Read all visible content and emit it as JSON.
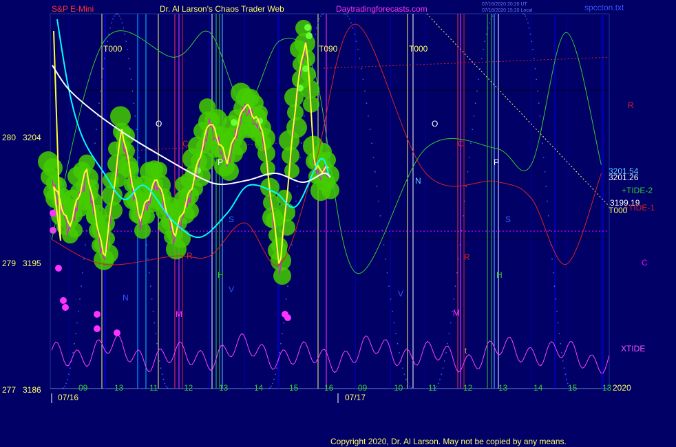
{
  "header": {
    "instrument": "S&P E-Mini",
    "site_title": "Dr. Al Larson's Chaos Trader Web",
    "site_url": "Daytradingforecasts.com",
    "stamp_line1": "07/16/2020 20:20 UT",
    "stamp_line2": "07/16/2020 15:20 Local",
    "file_name": "spccton.txt"
  },
  "footer": {
    "copyright": "Copyright 2020, Dr. Al Larson. May not be copied by any means."
  },
  "chart_data": {
    "type": "line",
    "title": "",
    "y_axis": {
      "ylim": [
        3186,
        3209
      ],
      "ticks": [
        {
          "left": "280",
          "value": 3204,
          "label": "3204"
        },
        {
          "left": "279",
          "value": 3195,
          "label": "3195"
        },
        {
          "left": "277",
          "value": 3186,
          "label": "3186"
        }
      ]
    },
    "x_axis": {
      "days": [
        "07/16",
        "07/17"
      ],
      "year_label": "2020",
      "hours": [
        "09",
        "10",
        "11",
        "12",
        "13",
        "14",
        "15",
        "16",
        "09",
        "10",
        "11",
        "12",
        "13",
        "14",
        "15",
        "16"
      ],
      "hour_labels_shown": [
        "09",
        "13",
        "11",
        "12",
        "13",
        "14",
        "15",
        "16",
        "09",
        "10",
        "11",
        "12",
        "13",
        "14",
        "15",
        "13"
      ]
    },
    "right_labels": {
      "tide2": "+TIDE-2",
      "tide1": "+TIDE-1",
      "xtide": "XTIDE",
      "r": "R",
      "c": "C",
      "p_3201_54": "3201.54",
      "p_3201_26": "3201.26",
      "p_3199_19": "3199.19",
      "t000": "T000"
    },
    "vertical_line_labels": [
      {
        "text": "T000",
        "day": "07/16",
        "time": "10:00"
      },
      {
        "text": "T090",
        "day": "07/16",
        "time": "16:00"
      },
      {
        "text": "T000",
        "day": "07/17",
        "time": "10:30"
      }
    ],
    "planet_labels": [
      "O",
      "C",
      "P",
      "S",
      "H",
      "N",
      "V",
      "M",
      "R",
      "O",
      "C",
      "N",
      "P",
      "S",
      "H",
      "V",
      "M",
      "R",
      "t"
    ],
    "series": [
      {
        "name": "price",
        "color": "#ff00ff",
        "x": [
          "07/16 08:30",
          "07/16 09:00",
          "07/16 09:30",
          "07/16 10:00",
          "07/16 10:30",
          "07/16 11:00",
          "07/16 11:30",
          "07/16 12:00",
          "07/16 12:30",
          "07/16 13:00",
          "07/16 13:30",
          "07/16 14:00",
          "07/16 14:30",
          "07/16 15:00",
          "07/16 15:30",
          "07/16 15:45",
          "07/16 16:00"
        ],
        "y": [
          3198.5,
          3195.5,
          3199,
          3193.5,
          3201.5,
          3196,
          3198.5,
          3195,
          3198,
          3202,
          3199.5,
          3203,
          3201.5,
          3193,
          3204,
          3207,
          3199
        ]
      },
      {
        "name": "+TIDE-2",
        "color": "#33cc33",
        "x": [
          "07/16 08:30",
          "07/16 10:00",
          "07/16 12:00",
          "07/16 13:00",
          "07/16 14:00",
          "07/16 15:00",
          "07/16 16:00",
          "07/17 09:00",
          "07/17 11:00",
          "07/17 13:00",
          "07/17 14:00",
          "07/17 15:00",
          "07/17 16:00"
        ],
        "y": [
          3195,
          3207,
          3206,
          3207.5,
          3203,
          3207,
          3205,
          3193,
          3200.5,
          3200.5,
          3199.5,
          3207.5,
          3199.5
        ]
      },
      {
        "name": "+TIDE-1",
        "color": "#dd2222",
        "x": [
          "07/16 08:30",
          "07/16 10:00",
          "07/16 12:00",
          "07/16 13:00",
          "07/16 14:00",
          "07/16 15:00",
          "07/16 16:00",
          "07/17 09:00",
          "07/17 11:00",
          "07/17 13:00",
          "07/17 14:00",
          "07/17 15:00",
          "07/17 16:00"
        ],
        "y": [
          3195,
          3193.5,
          3194,
          3194,
          3196,
          3193.5,
          3199.5,
          3208,
          3199,
          3198.5,
          3197.5,
          3193.5,
          3199
        ]
      }
    ],
    "reference_lines": [
      {
        "label": "C",
        "value": 3195.5,
        "color": "#ff00ff"
      },
      {
        "label": "R",
        "value": 3206,
        "color": "#dd2222"
      }
    ]
  }
}
